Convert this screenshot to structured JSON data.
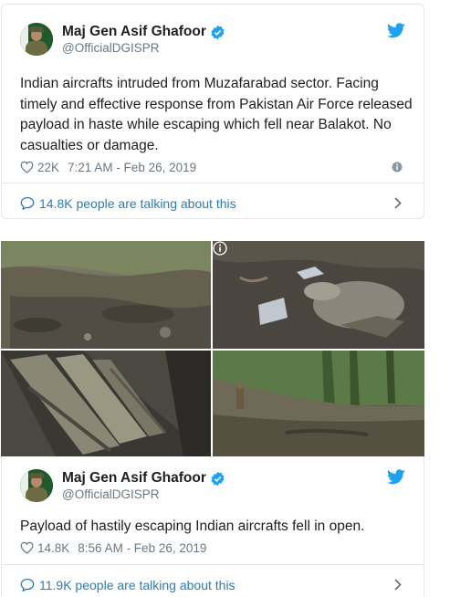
{
  "tweets": [
    {
      "name": "Maj Gen Asif Ghafoor",
      "handle": "@OfficialDGISPR",
      "text": "Indian aircrafts intruded from Muzafarabad sector. Facing timely and effective response from Pakistan Air Force released payload in haste while escaping which fell near Balakot. No casualties or damage.",
      "likes": "22K",
      "timestamp": "7:21 AM - Feb 26, 2019",
      "talking": "14.8K people are talking about this"
    },
    {
      "name": "Maj Gen Asif Ghafoor",
      "handle": "@OfficialDGISPR",
      "text": "Payload of hastily escaping Indian aircrafts fell in open.",
      "likes": "14.8K",
      "timestamp": "8:56 AM - Feb 26, 2019",
      "talking": "11.9K people are talking about this"
    }
  ],
  "icons": {
    "verified": "verified-badge-icon",
    "twitter": "twitter-bird-icon",
    "like": "heart-icon",
    "info": "info-icon",
    "comment": "comment-icon",
    "chevron": "chevron-right-icon"
  },
  "colors": {
    "link": "#2b7bb9",
    "twitter_blue": "#1da1f2",
    "muted": "#697882",
    "border": "#e1e8ed"
  }
}
